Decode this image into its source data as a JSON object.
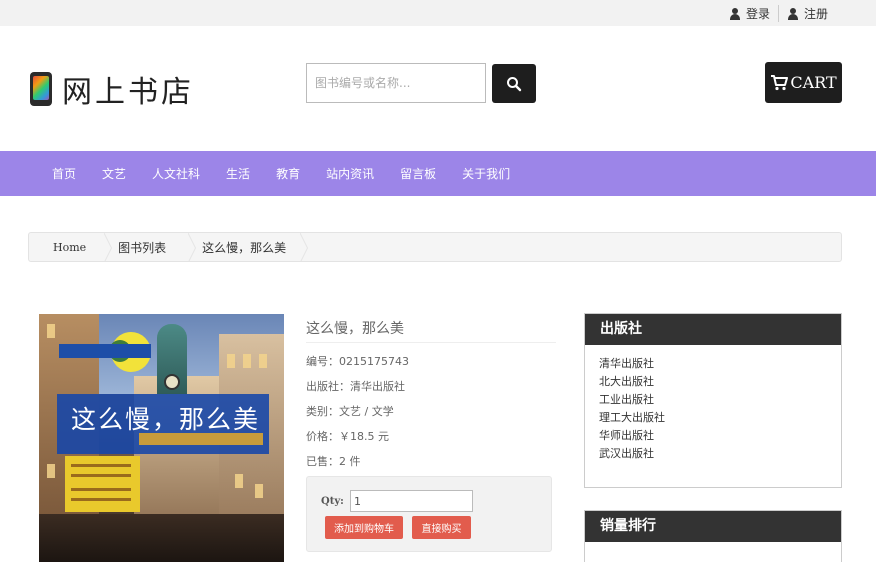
{
  "topbar": {
    "login": "登录",
    "register": "注册"
  },
  "header": {
    "logo_text": "网上书店",
    "search_placeholder": "图书编号或名称...",
    "cart_label": "CART"
  },
  "nav": {
    "items": [
      "首页",
      "文艺",
      "人文社科",
      "生活",
      "教育",
      "站内资讯",
      "留言板",
      "关于我们"
    ]
  },
  "breadcrumb": {
    "home": "Home",
    "list": "图书列表",
    "current": "这么慢，那么美"
  },
  "cover": {
    "title": "这么慢，那么美"
  },
  "product": {
    "title": "这么慢，那么美",
    "code": "编号：0215175743",
    "publisher": "出版社：清华出版社",
    "category": "类别：文艺 / 文学",
    "price": "价格：￥18.5 元",
    "sold": "已售：2 件",
    "qty_label": "Qty:",
    "qty_value": "1",
    "add_cart": "添加到购物车",
    "buy_now": "直接购买"
  },
  "sidebar": {
    "publishers_title": "出版社",
    "publishers": [
      "清华出版社",
      "北大出版社",
      "工业出版社",
      "理工大出版社",
      "华师出版社",
      "武汉出版社"
    ],
    "ranking_title": "销量排行"
  },
  "colors": {
    "nav": "#9c85e8",
    "dark": "#1e1e1e",
    "accent_red": "#e25c4d"
  }
}
